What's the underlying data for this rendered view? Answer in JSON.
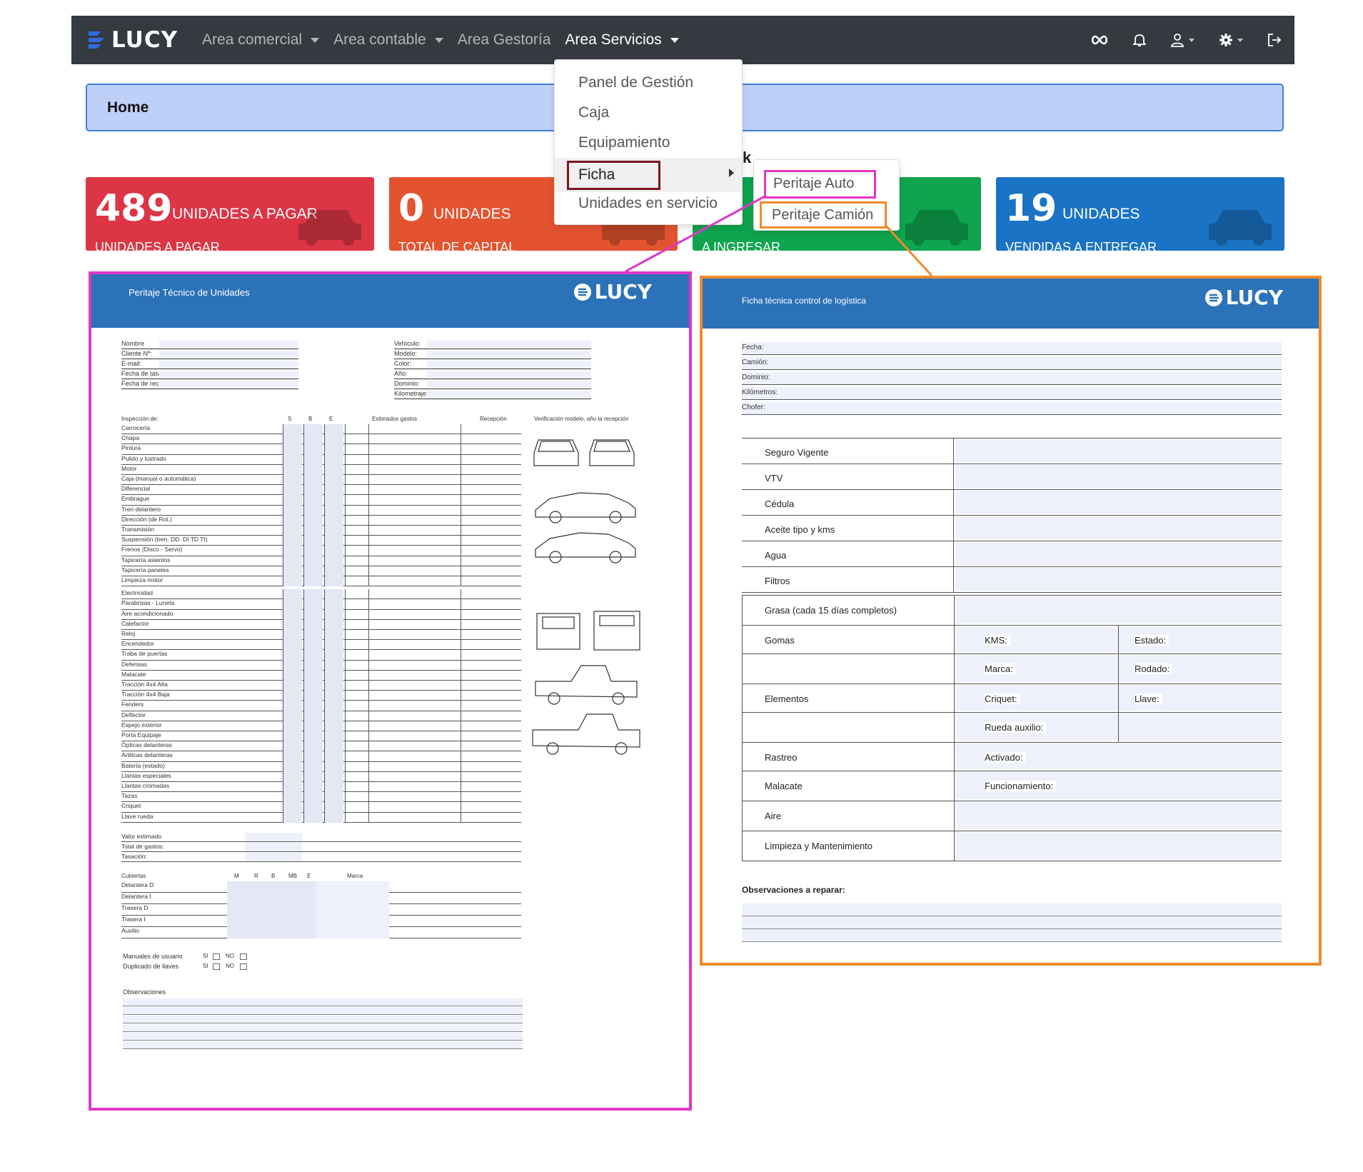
{
  "navbar": {
    "brand": "LUCY",
    "items": [
      {
        "label": "Area comercial",
        "dropdown": true
      },
      {
        "label": "Area contable",
        "dropdown": true
      },
      {
        "label": "Area Gestoría",
        "dropdown": false
      },
      {
        "label": "Area Servicios",
        "dropdown": true,
        "active": true
      }
    ],
    "icons": [
      "infinity-icon",
      "bell-icon",
      "user-icon",
      "gear-icon",
      "logout-icon"
    ]
  },
  "breadcrumb": {
    "title": "Home"
  },
  "stat_cards": [
    {
      "number": "489",
      "label": "UNIDADES A PAGAR",
      "sub": "UNIDADES A PAGAR",
      "color": "#dc3545"
    },
    {
      "number": "0",
      "label": "UNIDADES",
      "sub": "TOTAL DE CAPITAL",
      "color": "#e4532f"
    },
    {
      "number": "",
      "label": "",
      "sub": "A INGRESAR",
      "color": "#0ea54e"
    },
    {
      "number": "19",
      "label": "UNIDADES",
      "sub": "VENDIDAS A ENTREGAR",
      "color": "#1a73c4"
    }
  ],
  "dropdown": {
    "items": [
      "Panel de Gestión",
      "Caja",
      "Equipamiento",
      "Ficha",
      "Unidades en servicio"
    ],
    "partial_text": "k"
  },
  "submenu": {
    "items": [
      "Peritaje Auto",
      "Peritaje Camión"
    ]
  },
  "colors": {
    "magenta": "#e037c7",
    "orange": "#f08a2c",
    "ficha_border": "#7b1620",
    "navbar": "#343a40",
    "doc_header": "#2b72b9"
  },
  "doc_auto": {
    "title": "Peritaje Técnico de Unidades",
    "logo": "LUCY",
    "client_fields": [
      "Nombre",
      "Cliente Nº:",
      "E-mail:",
      "Fecha de tasación:",
      "Fecha de recepción:"
    ],
    "vehicle_fields": [
      "Vehículo:",
      "Modelo:",
      "Color:",
      "Año:",
      "Dominio:",
      "Kilometraje:"
    ],
    "inspection_header": [
      "Inspección de:",
      "S",
      "B",
      "E",
      "Estimados gastos",
      "Recepción",
      "Verificación modelo, año la recepción"
    ],
    "inspection_items_1": [
      "Carrocería",
      "Chapa",
      "Pintura",
      "Pulido y lustrado",
      "Motor",
      "Caja (manual o automática)",
      "Diferencial",
      "Embrague",
      "Tren delantero",
      "Dirección (de Rot.)",
      "Transmisión",
      "Suspensión (tren. DD. DI TD TI)",
      "Frenos (Disco - Servo)",
      "Tapicería asientos",
      "Tapicería paneles",
      "Limpieza motor"
    ],
    "inspection_items_2": [
      "Electricidad",
      "Parabrisas - Luneta",
      "Aire acondicionado",
      "Calefactor",
      "Reloj",
      "Encendedor",
      "Traba de puertas",
      "Defensas",
      "Malacate",
      "Tracción 4x4 Alta",
      "Tracción 4x4 Baja",
      "Fenders",
      "Deflector",
      "Espejo exterior",
      "Porta Equipaje",
      "Ópticas delanteras",
      "Artilicas delanteras",
      "Batería (estado)",
      "Llantas especiales",
      "Llantas cromadas",
      "Tazas",
      "Criquet",
      "Llave rueda"
    ],
    "summary": [
      "Valor estimado",
      "Total de gastos:",
      "Tasación:"
    ],
    "tires_header": [
      "Cubiertas",
      "M",
      "R",
      "B",
      "MB",
      "E",
      "Marca"
    ],
    "tires": [
      "Delantera D",
      "Delantera I",
      "Trasera D",
      "Trasera I",
      "Auxilio"
    ],
    "extras": [
      {
        "label": "Manuales de usuario",
        "si": "SI",
        "no": "NO"
      },
      {
        "label": "Duplicado de llaves",
        "si": "SI",
        "no": "NO"
      }
    ],
    "observations": "Observaciones"
  },
  "doc_camion": {
    "title": "Ficha técnica control de logística",
    "logo": "LUCY",
    "fields": [
      "Fecha:",
      "Camión:",
      "Dominio:",
      "Kilómetros:",
      "Chofer:"
    ],
    "rows1": [
      "Seguro Vigente",
      "VTV",
      "Cédula",
      "Aceite tipo y kms",
      "Agua",
      "Filtros"
    ],
    "grasa": "Grasa (cada 15 días completos)",
    "gomas": "Gomas",
    "kms": "KMS:",
    "estado": "Estado:",
    "marca": "Marca:",
    "rodado": "Rodado:",
    "elementos": "Elementos",
    "criquet": "Criquet:",
    "llave": "Llave:",
    "rueda_auxilio": "Rueda auxilio:",
    "rastreo": "Rastreo",
    "activado": "Activado:",
    "malacate": "Malacate",
    "funcionamiento": "Funcionamiento:",
    "aire": "Aire",
    "limpieza": "Limpieza y Mantenimiento",
    "observaciones": "Observaciones a reparar:"
  }
}
